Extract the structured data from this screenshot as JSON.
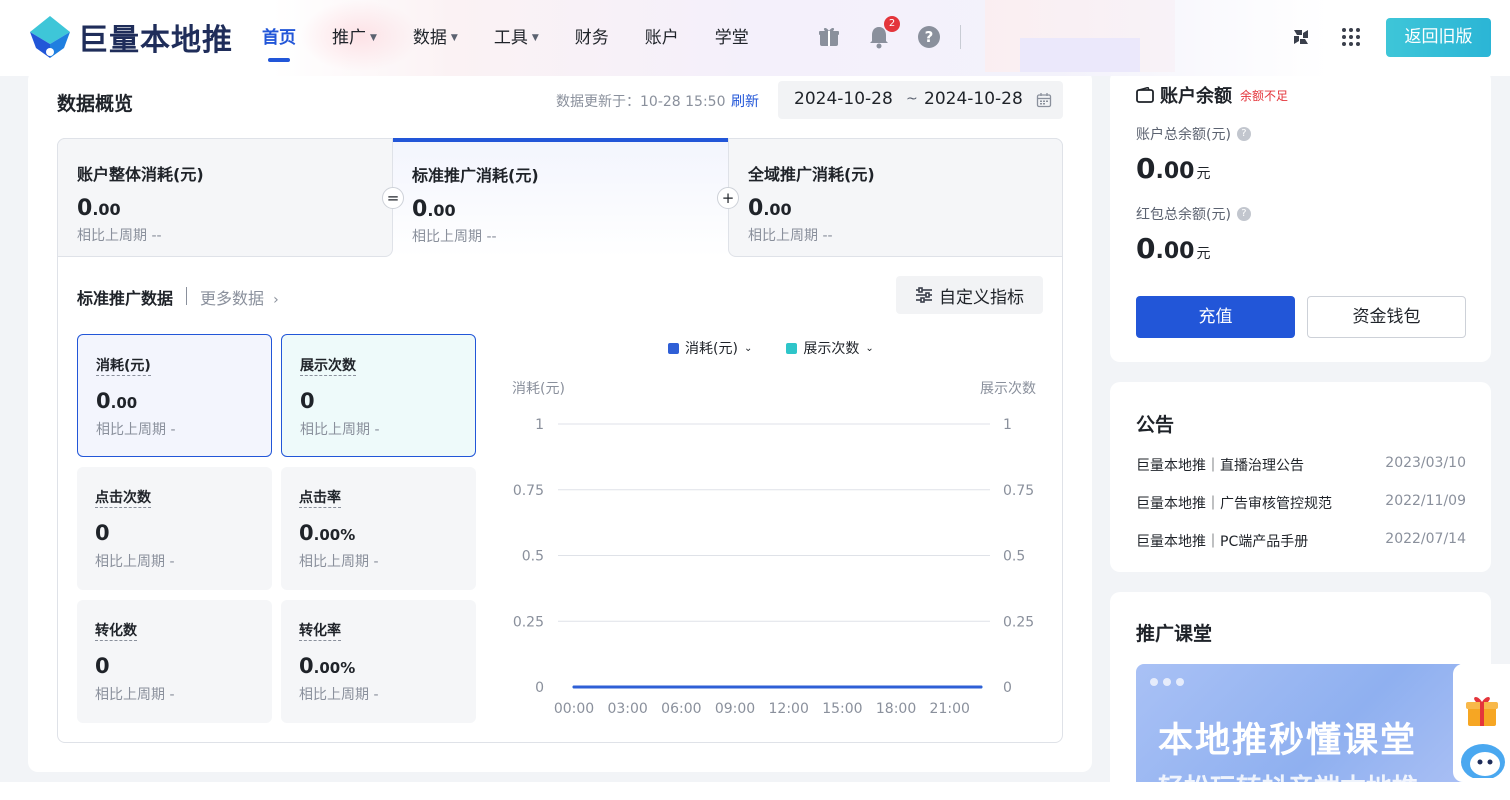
{
  "header": {
    "logo_text": "巨量本地推",
    "nav": [
      {
        "label": "首页",
        "active": true,
        "has_caret": false
      },
      {
        "label": "推广",
        "active": false,
        "has_caret": true
      },
      {
        "label": "数据",
        "active": false,
        "has_caret": true
      },
      {
        "label": "工具",
        "active": false,
        "has_caret": true
      },
      {
        "label": "财务",
        "active": false,
        "has_caret": false
      },
      {
        "label": "账户",
        "active": false,
        "has_caret": false
      },
      {
        "label": "学堂",
        "active": false,
        "has_caret": false
      }
    ],
    "notification_count": "2",
    "old_version_label": "返回旧版",
    "icons": [
      "gift-icon",
      "bell-icon",
      "help-icon",
      "app-switch-icon",
      "grid-icon"
    ]
  },
  "overview": {
    "title": "数据概览",
    "update_text": "数据更新于：10-28 15:50",
    "refresh_label": "刷新",
    "date_start": "2024-10-28",
    "date_sep": "~",
    "date_end": "2024-10-28"
  },
  "summary_cards": [
    {
      "title": "账户整体消耗(元)",
      "value_int": "0",
      "value_dec": ".00",
      "compare": "相比上周期 --"
    },
    {
      "title": "标准推广消耗(元)",
      "value_int": "0",
      "value_dec": ".00",
      "compare": "相比上周期 --"
    },
    {
      "title": "全域推广消耗(元)",
      "value_int": "0",
      "value_dec": ".00",
      "compare": "相比上周期 --"
    }
  ],
  "operators": [
    "=",
    "+"
  ],
  "standard": {
    "title": "标准推广数据",
    "more_label": "更多数据",
    "custom_label": "自定义指标",
    "metrics": [
      {
        "title": "消耗(元)",
        "value_int": "0",
        "value_dec": ".00",
        "compare": "相比上周期  -",
        "state": "selected-blue"
      },
      {
        "title": "展示次数",
        "value_int": "0",
        "value_dec": "",
        "compare": "相比上周期  -",
        "state": "selected-teal"
      },
      {
        "title": "点击次数",
        "value_int": "0",
        "value_dec": "",
        "compare": "相比上周期  -",
        "state": "normal"
      },
      {
        "title": "点击率",
        "value_int": "0",
        "value_dec": ".00%",
        "compare": "相比上周期  -",
        "state": "normal"
      },
      {
        "title": "转化数",
        "value_int": "0",
        "value_dec": "",
        "compare": "相比上周期  -",
        "state": "normal"
      },
      {
        "title": "转化率",
        "value_int": "0",
        "value_dec": ".00%",
        "compare": "相比上周期  -",
        "state": "normal"
      }
    ]
  },
  "chart_data": {
    "type": "line",
    "x": [
      "00:00",
      "03:00",
      "06:00",
      "09:00",
      "12:00",
      "15:00",
      "18:00",
      "21:00"
    ],
    "series": [
      {
        "name": "消耗(元)",
        "color": "#2f5fd6",
        "values": [
          0,
          0,
          0,
          0,
          0,
          0,
          0,
          0
        ]
      },
      {
        "name": "展示次数",
        "color": "#2ec5c9",
        "values": [
          0,
          0,
          0,
          0,
          0,
          0,
          0,
          0
        ]
      }
    ],
    "ylabel_left": "消耗(元)",
    "ylabel_right": "展示次数",
    "yticks": [
      "0",
      "0.25",
      "0.5",
      "0.75",
      "1"
    ],
    "ylim": [
      0,
      1
    ],
    "grid": true,
    "legend": "top-center"
  },
  "account": {
    "title": "账户余额",
    "warning": "余额不足",
    "total_label": "账户总余额(元)",
    "total_int": "0",
    "total_dec": ".00",
    "total_unit": "元",
    "red_label": "红包总余额(元)",
    "red_int": "0",
    "red_dec": ".00",
    "red_unit": "元",
    "charge_label": "充值",
    "wallet_label": "资金钱包"
  },
  "notices": {
    "title": "公告",
    "items": [
      {
        "text": "巨量本地推｜直播治理公告",
        "date": "2023/03/10"
      },
      {
        "text": "巨量本地推｜广告审核管控规范",
        "date": "2022/11/09"
      },
      {
        "text": "巨量本地推｜PC端产品手册",
        "date": "2022/07/14"
      }
    ]
  },
  "classroom": {
    "title": "推广课堂",
    "banner_title": "本地推秒懂课堂",
    "banner_subtitle": "轻松玩转抖音端本地推"
  },
  "colors": {
    "brand": "#2256d8",
    "teal": "#2ec5c9",
    "danger": "#e4353b"
  }
}
